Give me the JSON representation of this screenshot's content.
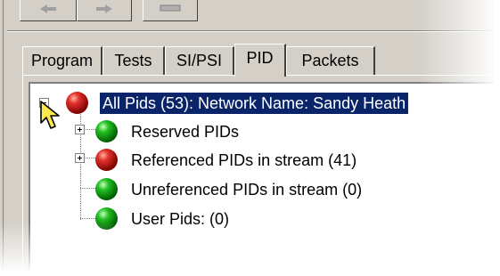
{
  "tabs": [
    {
      "label": "Program"
    },
    {
      "label": "Tests"
    },
    {
      "label": "SI/PSI"
    },
    {
      "label": "PID",
      "active": true
    },
    {
      "label": "Packets"
    }
  ],
  "tree": {
    "root": {
      "label": "All Pids (53): Network Name: Sandy Heath",
      "status": "red",
      "expanded": true,
      "selected": true
    },
    "children": [
      {
        "label": "Reserved PIDs",
        "status": "green",
        "expandable": true
      },
      {
        "label": "Referenced PIDs in stream (41)",
        "status": "red",
        "expandable": true
      },
      {
        "label": "Unreferenced PIDs in stream (0)",
        "status": "green",
        "expandable": false
      },
      {
        "label": "User Pids: (0)",
        "status": "green",
        "expandable": false
      }
    ]
  },
  "colors": {
    "selection": "#0a246a",
    "status_red": "#c8161b",
    "status_green": "#1aa81a",
    "face": "#d4d0c8"
  },
  "icons": {
    "cursor": "arrow-pointer-icon",
    "status": "status-ball-icon"
  }
}
